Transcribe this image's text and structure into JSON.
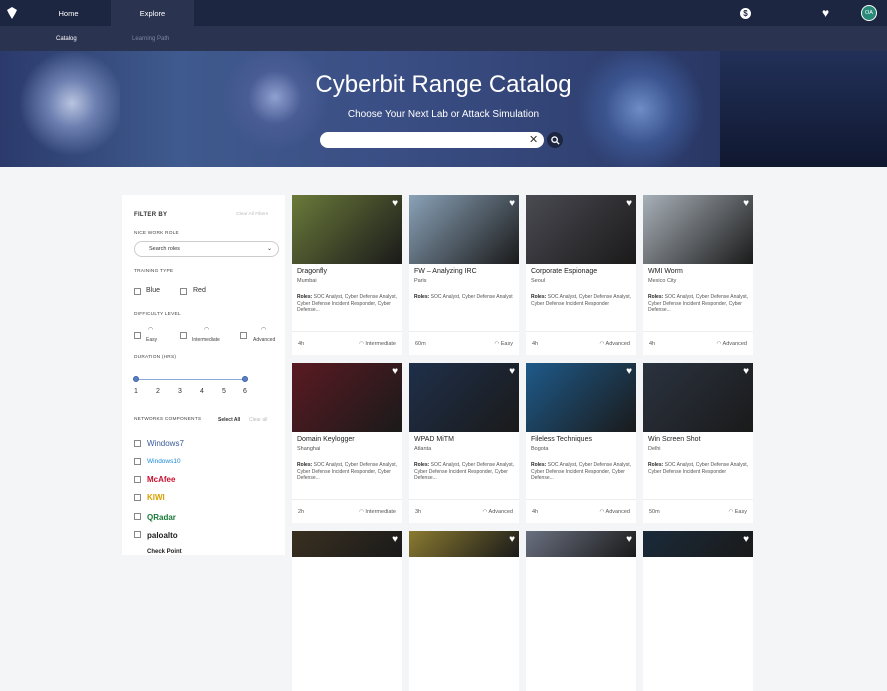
{
  "nav": {
    "home": "Home",
    "explore": "Explore",
    "catalog": "Catalog",
    "learning_path": "Learning Path",
    "avatar": "OA"
  },
  "hero": {
    "title": "Cyberbit Range Catalog",
    "subtitle": "Choose Your Next Lab or Attack Simulation",
    "search_value": ""
  },
  "filter": {
    "header": "FILTER BY",
    "clear_all": "Clear All Filters",
    "work_role_label": "NICE WORK ROLE",
    "roles_placeholder": "Search roles",
    "training_type_label": "TRAINING TYPE",
    "training_types": [
      "Blue",
      "Red"
    ],
    "difficulty_label": "DIFFICULTY LEVEL",
    "difficulties": [
      "Easy",
      "Intermediate",
      "Advanced"
    ],
    "duration_label": "DURATION (HRS)",
    "duration_ticks": [
      "1",
      "2",
      "3",
      "4",
      "5",
      "6"
    ],
    "networks_label": "NETWORKS COMPONENTS",
    "select_all": "Select All",
    "clear_all_small": "Clear all",
    "vendors": [
      "Windows7",
      "Windows10",
      "McAfee",
      "KIWI",
      "QRadar",
      "paloalto",
      "Check Point"
    ]
  },
  "cards": [
    {
      "title": "Dragonfly",
      "location": "Mumbai",
      "roles": "SOC Analyst, Cyber Defense Analyst, Cyber Defense Incident Responder, Cyber Defense...",
      "duration": "4h",
      "level": "Intermediate",
      "color": "#6b7a3a"
    },
    {
      "title": "FW – Analyzing IRC",
      "location": "Paris",
      "roles": "SOC Analyst, Cyber Defense Analyst",
      "duration": "60m",
      "level": "Easy",
      "color": "#8aa2b8"
    },
    {
      "title": "Corporate Espionage",
      "location": "Seoul",
      "roles": "SOC Analyst, Cyber Defense Analyst, Cyber Defense Incident Responder",
      "duration": "4h",
      "level": "Advanced",
      "color": "#4a4a52"
    },
    {
      "title": "WMI Worm",
      "location": "Mexico City",
      "roles": "SOC Analyst, Cyber Defense Analyst, Cyber Defense Incident Responder, Cyber Defense...",
      "duration": "4h",
      "level": "Advanced",
      "color": "#a8b0b8"
    },
    {
      "title": "Domain Keylogger",
      "location": "Shanghai",
      "roles": "SOC Analyst, Cyber Defense Analyst, Cyber Defense Incident Responder, Cyber Defense...",
      "duration": "2h",
      "level": "Intermediate",
      "color": "#5a1a22"
    },
    {
      "title": "WPAD MiTM",
      "location": "Atlanta",
      "roles": "SOC Analyst, Cyber Defense Analyst, Cyber Defense Incident Responder, Cyber Defense...",
      "duration": "3h",
      "level": "Advanced",
      "color": "#1f2f4a"
    },
    {
      "title": "Fileless Techniques",
      "location": "Bogota",
      "roles": "SOC Analyst, Cyber Defense Analyst, Cyber Defense Incident Responder, Cyber Defense...",
      "duration": "4h",
      "level": "Advanced",
      "color": "#1e5a8a"
    },
    {
      "title": "Win Screen Shot",
      "location": "Delhi",
      "roles": "SOC Analyst, Cyber Defense Analyst, Cyber Defense Incident Responder",
      "duration": "50m",
      "level": "Easy",
      "color": "#2b3340"
    },
    {
      "color": "#3a3020"
    },
    {
      "color": "#8a7a30"
    },
    {
      "color": "#6a7080"
    },
    {
      "color": "#1a2a3a"
    }
  ],
  "roles_prefix": "Roles:"
}
